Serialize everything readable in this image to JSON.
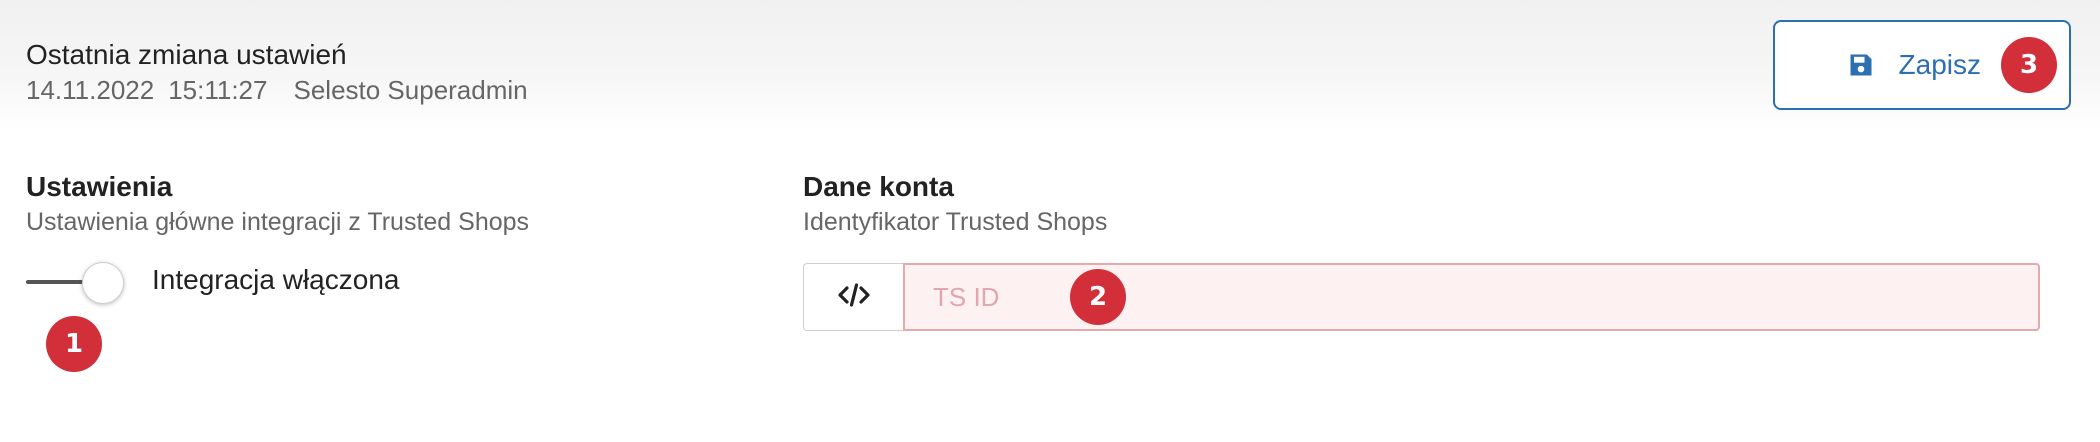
{
  "last_change": {
    "title": "Ostatnia zmiana ustawień",
    "date": "14.11.2022",
    "time": "15:11:27",
    "user": "Selesto Superadmin"
  },
  "save_button": {
    "label": "Zapisz",
    "icon": "floppy-disk-icon"
  },
  "settings": {
    "heading": "Ustawienia",
    "description": "Ustawienia główne integracji z Trusted Shops",
    "toggle": {
      "label": "Integracja włączona",
      "enabled": true
    }
  },
  "account": {
    "heading": "Dane konta",
    "description": "Identyfikator Trusted Shops",
    "input": {
      "prefix_icon": "code-icon",
      "placeholder": "TS ID",
      "value": ""
    }
  },
  "markers": [
    "1",
    "2",
    "3"
  ],
  "colors": {
    "accent": "#2d6fb3",
    "marker": "#d32f3a",
    "invalid_border": "#e5a9ae",
    "invalid_bg": "#fdf1f2"
  }
}
